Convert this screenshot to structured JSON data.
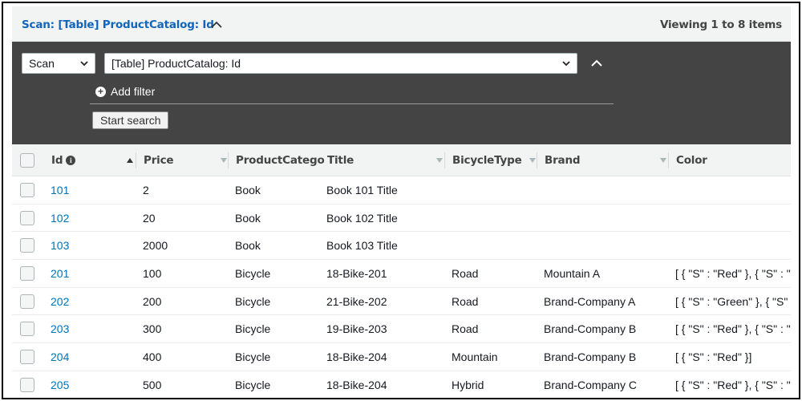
{
  "header": {
    "title": "Scan: [Table] ProductCatalog: Id",
    "count": "Viewing 1 to 8 items"
  },
  "search": {
    "mode": "Scan",
    "target": "[Table] ProductCatalog: Id",
    "add_filter_label": "Add filter",
    "start_label": "Start search"
  },
  "table": {
    "columns": [
      "Id",
      "Price",
      "ProductCatego",
      "Title",
      "BicycleType",
      "Brand",
      "Color"
    ],
    "rows": [
      [
        "101",
        "2",
        "Book",
        "Book 101 Title",
        "",
        "",
        ""
      ],
      [
        "102",
        "20",
        "Book",
        "Book 102 Title",
        "",
        "",
        ""
      ],
      [
        "103",
        "2000",
        "Book",
        "Book 103 Title",
        "",
        "",
        ""
      ],
      [
        "201",
        "100",
        "Bicycle",
        "18-Bike-201",
        "Road",
        "Mountain A",
        "[ { \"S\" : \"Red\" }, { \"S\" : \""
      ],
      [
        "202",
        "200",
        "Bicycle",
        "21-Bike-202",
        "Road",
        "Brand-Company A",
        "[ { \"S\" : \"Green\" }, { \"S\""
      ],
      [
        "203",
        "300",
        "Bicycle",
        "19-Bike-203",
        "Road",
        "Brand-Company B",
        "[ { \"S\" : \"Red\" }, { \"S\" : \""
      ],
      [
        "204",
        "400",
        "Bicycle",
        "18-Bike-204",
        "Mountain",
        "Brand-Company B",
        "[ { \"S\" : \"Red\" }]"
      ],
      [
        "205",
        "500",
        "Bicycle",
        "18-Bike-204",
        "Hybrid",
        "Brand-Company C",
        "[ { \"S\" : \"Red\" }, { \"S\" : \""
      ]
    ]
  },
  "icons": {
    "collapse": "chevron-up-icon",
    "dropdown": "chevron-down-icon",
    "add": "plus-circle-icon",
    "info": "info-icon",
    "sort": "sort-caret-icon"
  },
  "colors": {
    "link": "#0073bb",
    "title": "#1166bb",
    "panel": "#444444"
  }
}
